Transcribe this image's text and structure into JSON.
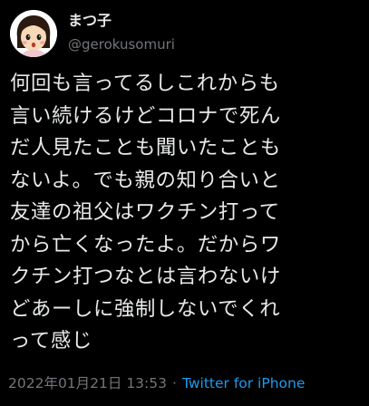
{
  "user": {
    "display_name": "まつ子",
    "handle": "@gerokusomuri",
    "avatar_icon": "cartoon-girl-avatar-icon"
  },
  "tweet": {
    "lines": [
      "何回も言ってるしこれからも",
      "言い続けるけどコロナで死ん",
      "だ人見たことも聞いたことも",
      "ないよ。でも親の知り合いと",
      "友達の祖父はワクチン打って",
      "から亡くなったよ。だからワ",
      "クチン打つなとは言わないけ",
      "どあーしに強制しないでくれ",
      "って感じ"
    ]
  },
  "meta": {
    "timestamp": "2022年01月21日 13:53",
    "separator": "·",
    "source": "Twitter for iPhone"
  },
  "colors": {
    "background": "#000000",
    "text": "#e7e9ea",
    "secondary": "#71767b",
    "link": "#1d9bf0"
  }
}
